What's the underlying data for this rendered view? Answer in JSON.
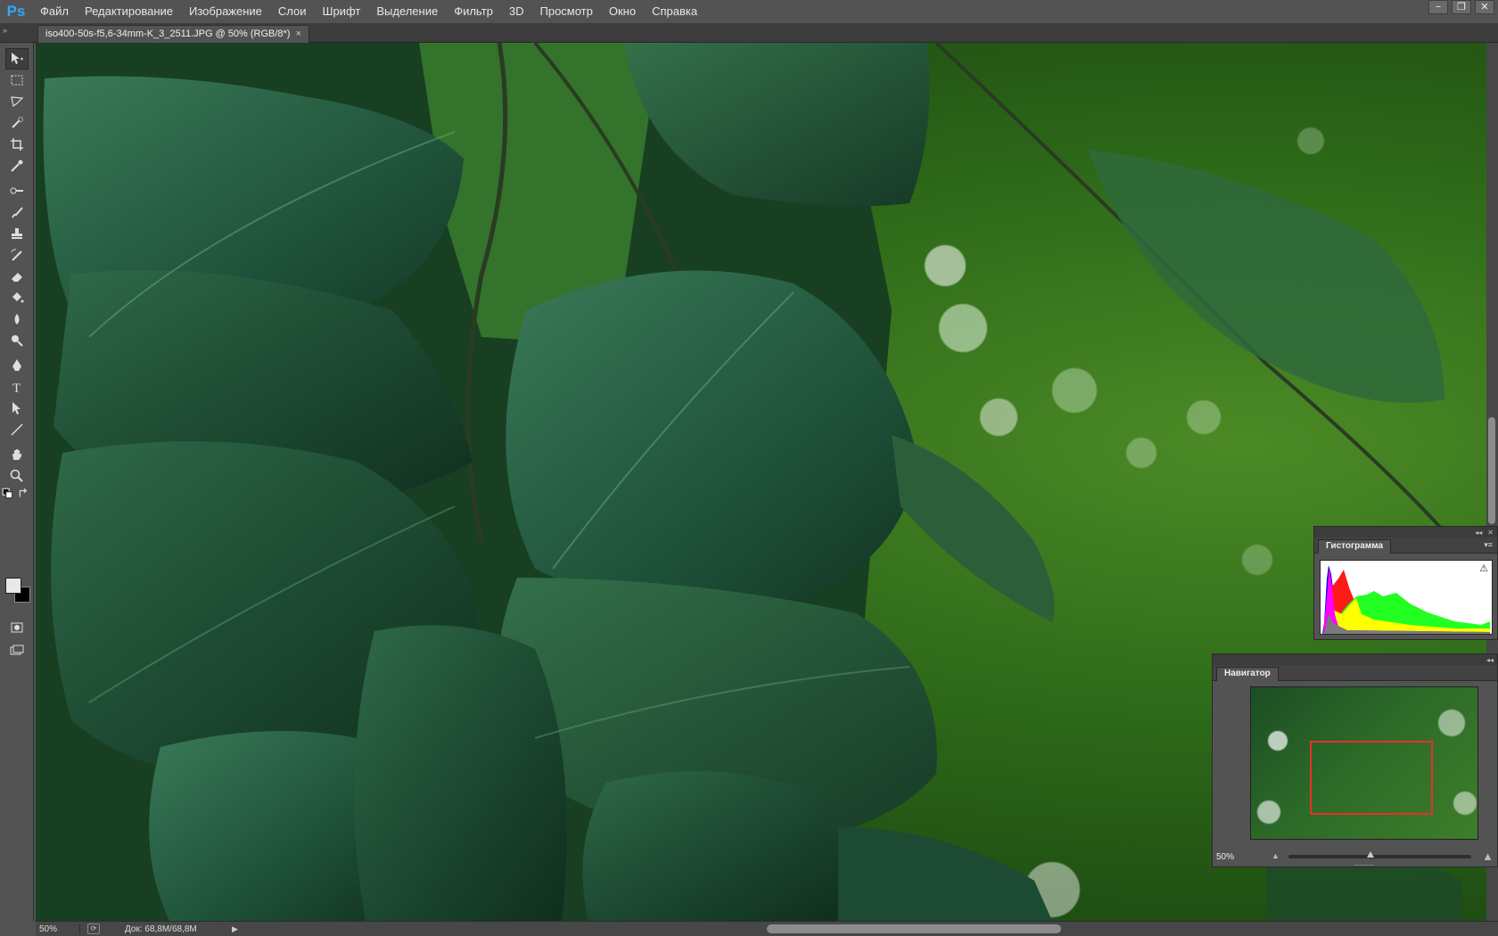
{
  "app": {
    "logo": "Ps"
  },
  "menu": [
    "Файл",
    "Редактирование",
    "Изображение",
    "Слои",
    "Шрифт",
    "Выделение",
    "Фильтр",
    "3D",
    "Просмотр",
    "Окно",
    "Справка"
  ],
  "window_controls": {
    "minimize": "−",
    "restore": "❐",
    "close": "✕"
  },
  "document_tab": {
    "title": "iso400-50s-f5,6-34mm-K_3_2511.JPG @ 50% (RGB/8*)",
    "close": "×"
  },
  "tools": [
    "move-tool",
    "marquee-tool",
    "lasso-tool",
    "quick-selection-tool",
    "crop-tool",
    "eyedropper-tool",
    "spot-healing-tool",
    "brush-tool",
    "clone-stamp-tool",
    "history-brush-tool",
    "eraser-tool",
    "paint-bucket-tool",
    "blur-tool",
    "dodge-tool",
    "pen-tool",
    "type-tool",
    "path-selection-tool",
    "line-tool",
    "hand-tool",
    "zoom-tool"
  ],
  "colors": {
    "foreground": "#e8e8e8",
    "background": "#000000",
    "accent": "#31a8ff",
    "nav_rect": "#e5312a"
  },
  "status": {
    "zoom": "50%",
    "doc": "Док: 68,8M/68,8M"
  },
  "histogram": {
    "title": "Гистограмма",
    "warning": "⚠"
  },
  "navigator": {
    "title": "Навигатор",
    "zoom": "50%",
    "zoom_level": 0.5
  }
}
